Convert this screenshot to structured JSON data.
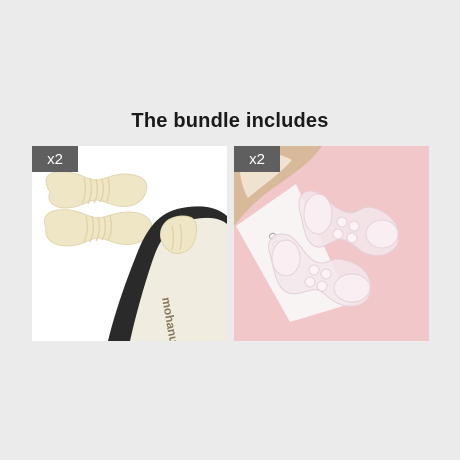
{
  "heading": "The bundle includes",
  "products": [
    {
      "badge": "x2",
      "image_name": "foam-heel-grip-pads",
      "shoe_print": "mohanu",
      "background": "#ffffff",
      "pad_color": "#efe6c6"
    },
    {
      "badge": "x2",
      "image_name": "clear-gel-heel-grip-pads",
      "card_print": "OUTI",
      "background": "#f2c7c9",
      "pad_color": "#f3e7ec"
    }
  ]
}
